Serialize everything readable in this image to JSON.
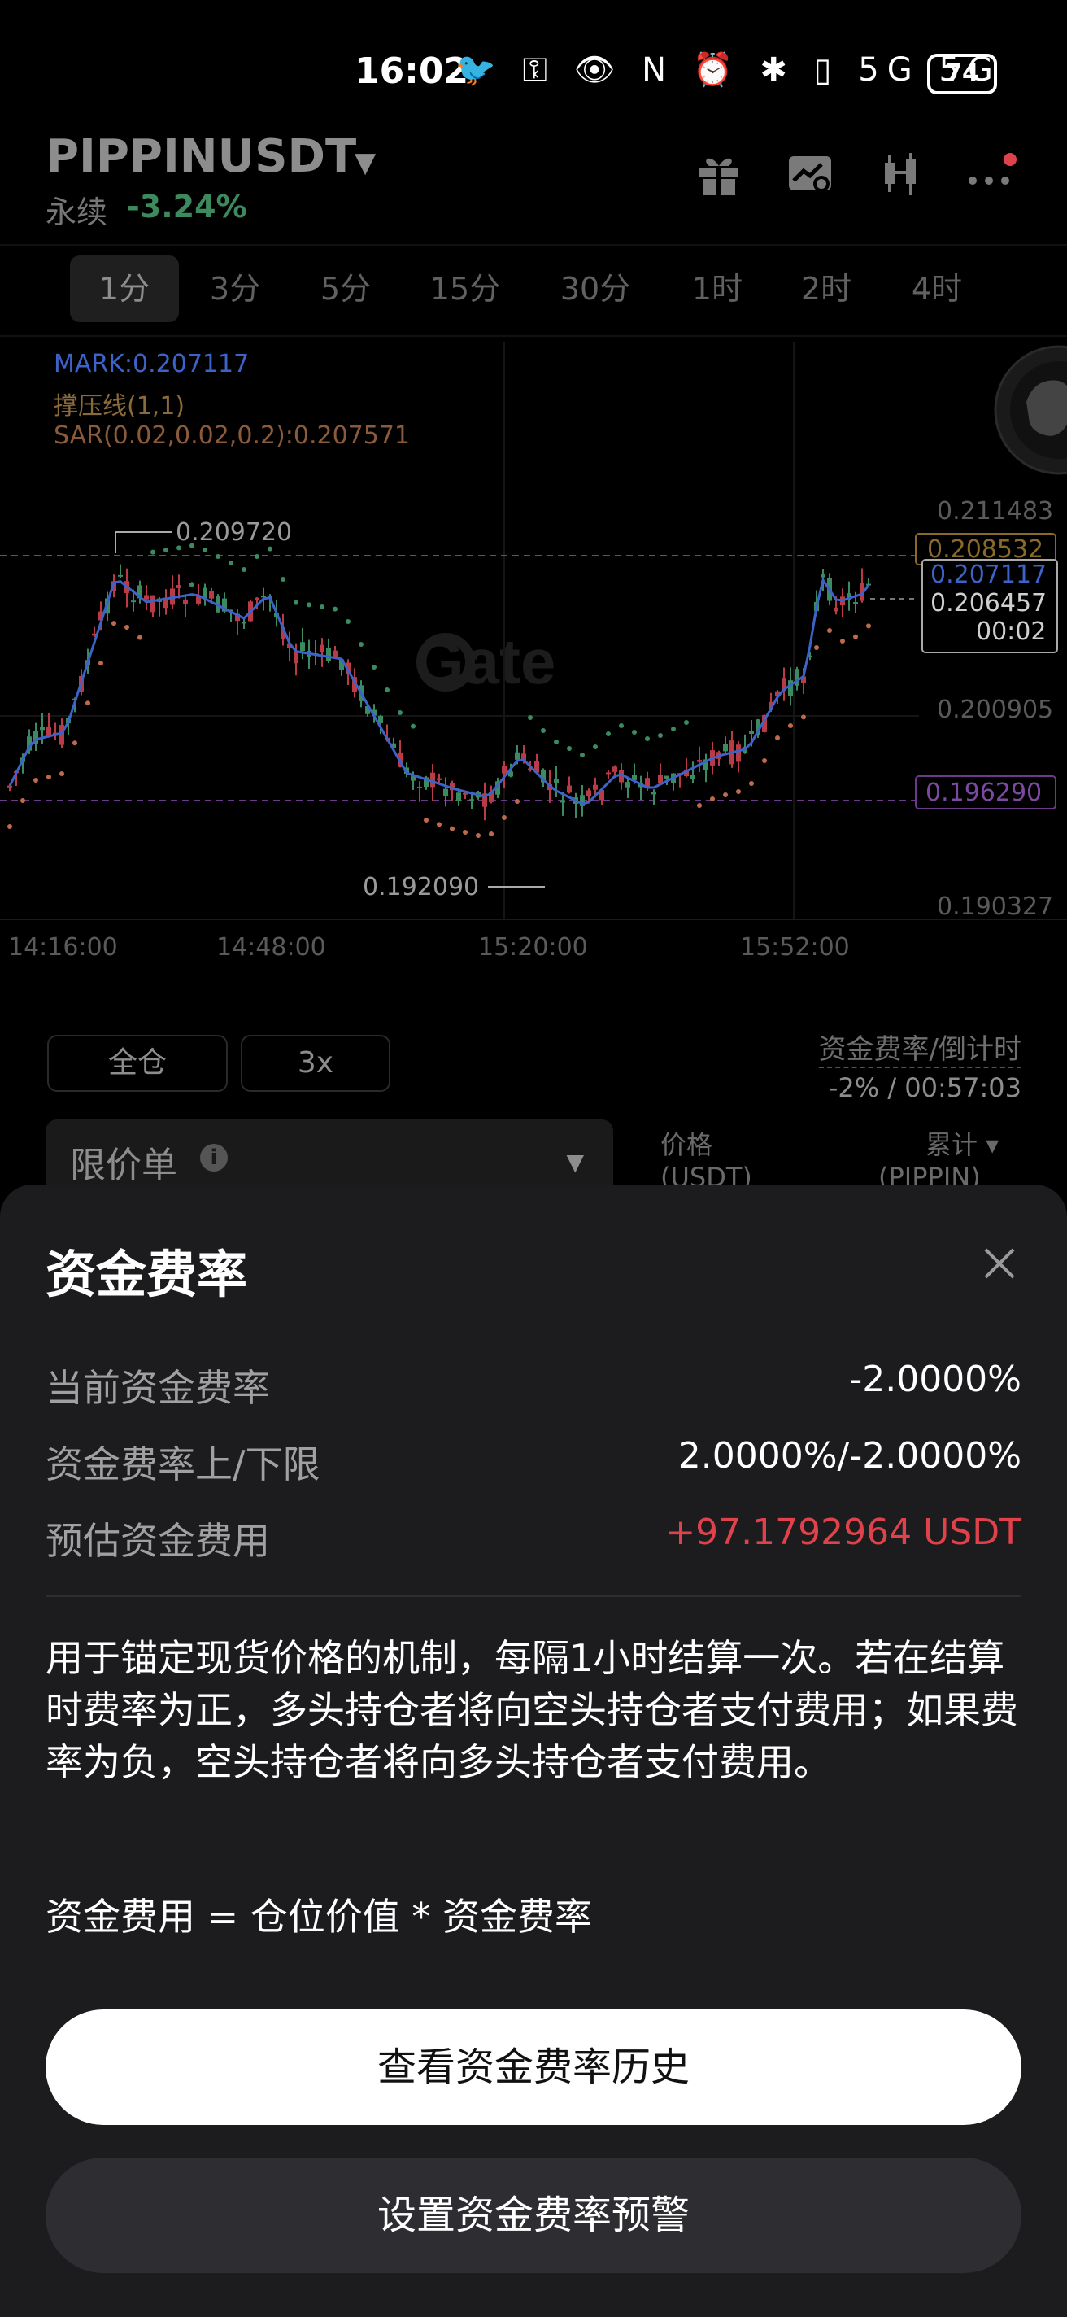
{
  "status_bar": {
    "time": "16:02",
    "icons": "🐦 ⚿ 👁 N ⏰ ✱ ▯ 5G 5G",
    "battery": "74"
  },
  "header": {
    "symbol": "PIPPINUSDT",
    "contract_type": "永续",
    "change": "-3.24%",
    "change_color": "#3e8a5f",
    "icons": [
      "gift-icon",
      "chart-compare-icon",
      "candlestick-icon",
      "more-icon"
    ]
  },
  "timeframes": [
    {
      "label": "1分",
      "active": true
    },
    {
      "label": "3分"
    },
    {
      "label": "5分"
    },
    {
      "label": "15分"
    },
    {
      "label": "30分"
    },
    {
      "label": "1时"
    },
    {
      "label": "2时"
    },
    {
      "label": "4时"
    }
  ],
  "chart": {
    "indicators": {
      "mark": "MARK:0.207117",
      "sr": "撑压线(1,1)",
      "sar": "SAR(0.02,0.02,0.2):0.207571"
    },
    "watermark": "Gate",
    "high_label": "0.209720",
    "low_label": "0.192090",
    "price_axis": [
      "0.211483",
      "0.208532",
      "0.207117",
      "0.206457",
      "00:02",
      "0.200905",
      "0.196290",
      "0.190327"
    ],
    "time_axis": [
      "14:16:00",
      "14:48:00",
      "15:20:00",
      "15:52:00"
    ],
    "colors": {
      "up": "#3a8a62",
      "down": "#b83b45",
      "mark": "#3c63c9",
      "sar": "#c06a4d"
    }
  },
  "order_panel": {
    "margin_mode": "全仓",
    "leverage": "3x",
    "funding_label": "资金费率/倒计时",
    "funding_value": "-2% / 00:57:03",
    "order_type": "限价单",
    "order_info": "i",
    "col_price": "价格",
    "col_price_unit": "(USDT)",
    "col_total": "累计 ▾",
    "col_total_unit": "(PIPPIN)"
  },
  "sheet": {
    "title": "资金费率",
    "rows": [
      {
        "label": "当前资金费率",
        "value": "-2.0000%"
      },
      {
        "label": "资金费率上/下限",
        "value": "2.0000%/-2.0000%"
      },
      {
        "label": "预估资金费用",
        "value": "+97.1792964 USDT"
      }
    ],
    "description": "用于锚定现货价格的机制，每隔1小时结算一次。若在结算时费率为正，多头持仓者将向空头持仓者支付费用；如果费率为负，空头持仓者将向多头持仓者支付费用。",
    "formula": "资金费用 = 仓位价值 * 资金费率",
    "primary_button": "查看资金费率历史",
    "secondary_button": "设置资金费率预警"
  }
}
